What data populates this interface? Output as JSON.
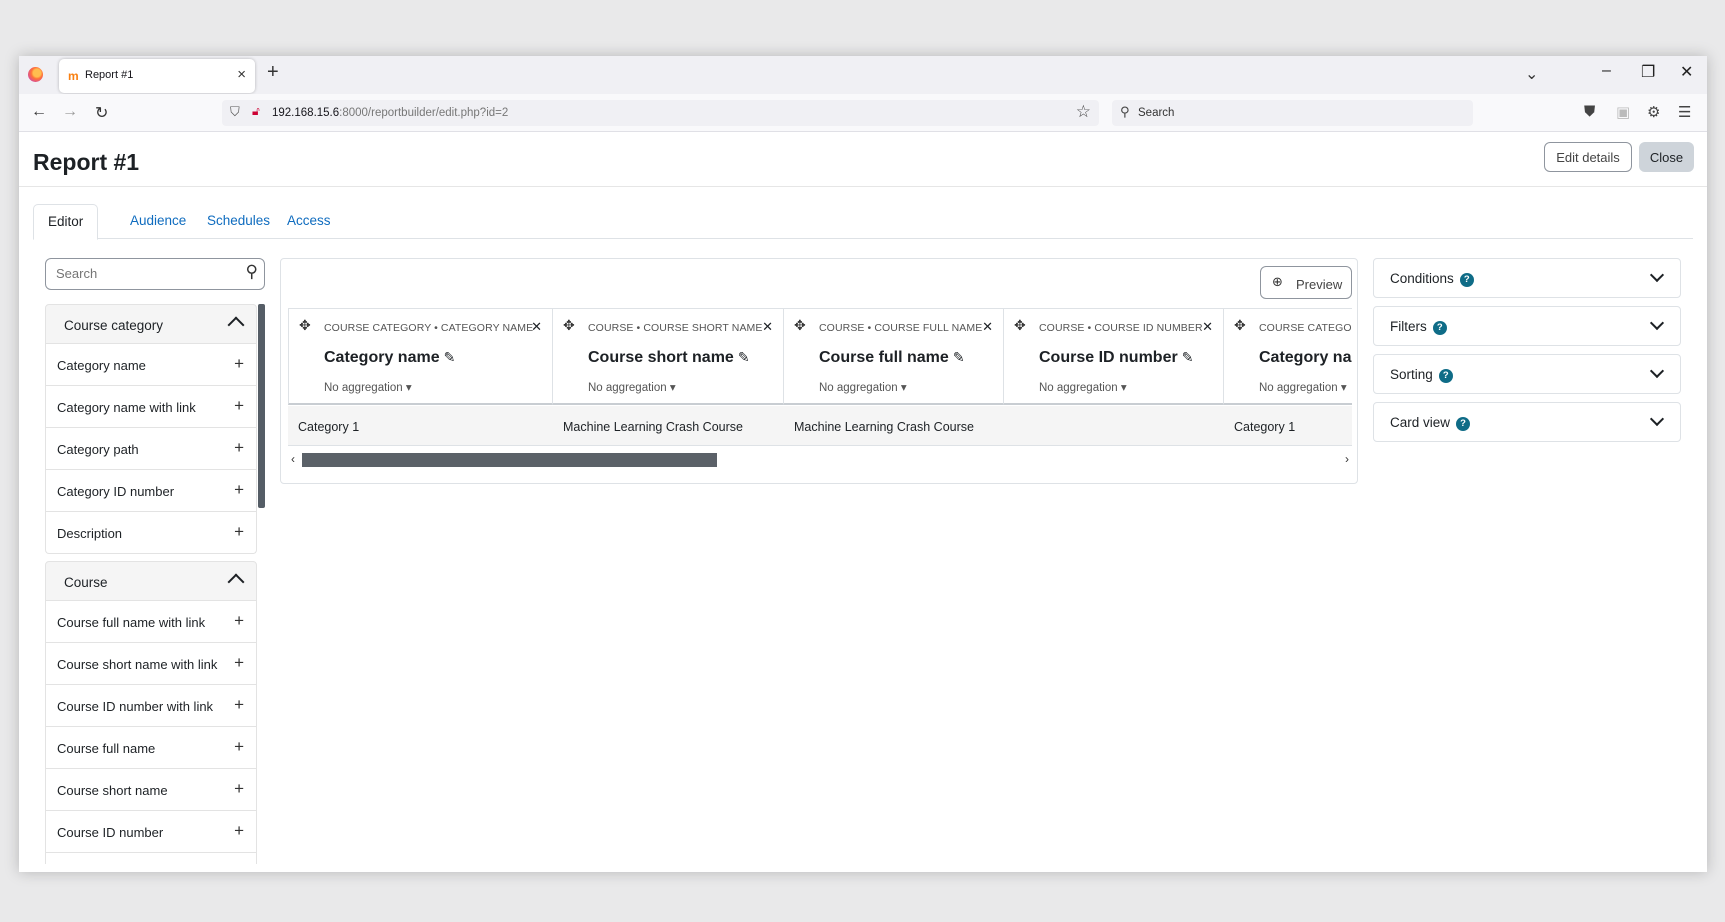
{
  "browser": {
    "tab_title": "Report #1",
    "tab_favicon": "m",
    "url_host": "192.168.15.6",
    "url_rest": ":8000/reportbuilder/edit.php?id=2",
    "search_placeholder": "Search"
  },
  "page": {
    "title": "Report #1",
    "edit_details": "Edit details",
    "close": "Close",
    "tabs": [
      {
        "label": "Editor"
      },
      {
        "label": "Audience"
      },
      {
        "label": "Schedules"
      },
      {
        "label": "Access"
      }
    ]
  },
  "sidebar": {
    "search_placeholder": "Search",
    "groups": [
      {
        "label": "Course category",
        "items": [
          "Category name",
          "Category name with link",
          "Category path",
          "Category ID number",
          "Description"
        ]
      },
      {
        "label": "Course",
        "items": [
          "Course full name with link",
          "Course short name with link",
          "Course ID number with link",
          "Course full name",
          "Course short name",
          "Course ID number"
        ]
      }
    ]
  },
  "report": {
    "preview_label": "Preview",
    "columns": [
      {
        "source": "COURSE CATEGORY • CATEGORY NAME",
        "heading": "Category name",
        "aggregation": "No aggregation"
      },
      {
        "source": "COURSE • COURSE SHORT NAME",
        "heading": "Course short name",
        "aggregation": "No aggregation"
      },
      {
        "source": "COURSE • COURSE FULL NAME",
        "heading": "Course full name",
        "aggregation": "No aggregation"
      },
      {
        "source": "COURSE • COURSE ID NUMBER",
        "heading": "Course ID number",
        "aggregation": "No aggregation"
      },
      {
        "source": "COURSE CATEGOR",
        "heading": "Category na",
        "aggregation": "No aggregation"
      }
    ],
    "row": [
      "Category 1",
      "Machine Learning Crash Course",
      "Machine Learning Crash Course",
      "",
      "Category 1"
    ]
  },
  "right_panel": {
    "cards": [
      {
        "label": "Conditions"
      },
      {
        "label": "Filters"
      },
      {
        "label": "Sorting"
      },
      {
        "label": "Card view"
      }
    ],
    "help_glyph": "?"
  },
  "icons": {
    "firefox": "firefox-logo-icon",
    "back": "←",
    "forward": "→",
    "reload": "↻",
    "plus": "+",
    "close": "×",
    "move": "✥",
    "pencil": "✎",
    "caret": "▾",
    "magnifier": "⚲"
  }
}
